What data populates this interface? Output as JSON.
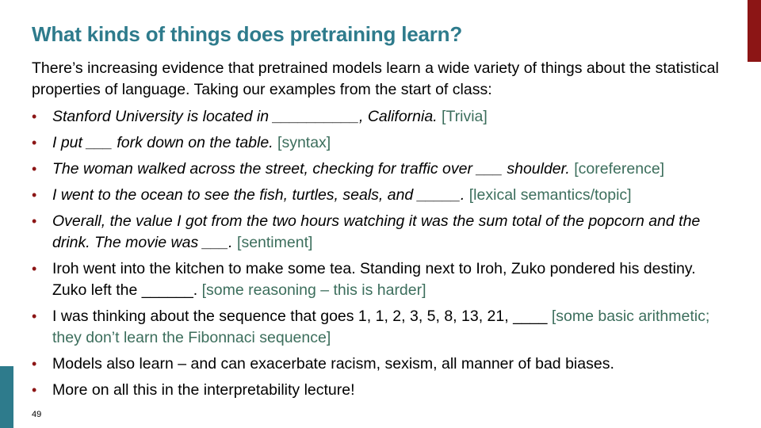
{
  "slide": {
    "title": "What kinds of things does pretraining learn?",
    "intro": "There’s increasing evidence that pretrained models learn a wide variety of things about the statistical properties of language. Taking our examples from the start of class:",
    "page_number": "49",
    "colors": {
      "title": "#2e7b8c",
      "bullet": "#8c1515",
      "tag": "#3c6e5c",
      "accent_right": "#8c1515",
      "accent_left": "#2e7b8c"
    }
  },
  "bullets": [
    {
      "text": "Stanford University is located in __________, California.",
      "tag": "[Trivia]"
    },
    {
      "text": "I put ___ fork down on the table.",
      "tag": "[syntax]"
    },
    {
      "text": "The woman walked across the street, checking for traffic over ___ shoulder.",
      "tag": "[coreference]"
    },
    {
      "text": "I went to the ocean to see the fish, turtles, seals, and _____.",
      "tag": " [lexical semantics/topic]"
    },
    {
      "text": "Overall, the value I got from the two hours watching it was the sum total of the popcorn and the drink. The movie was ___.",
      "tag": "[sentiment]"
    },
    {
      "text": "Iroh went into the kitchen to make some tea. Standing next to Iroh, Zuko pondered his destiny. Zuko left the ______.",
      "tag": "[some reasoning – this is harder]"
    },
    {
      "text": "I was thinking about the sequence that goes 1, 1, 2, 3, 5, 8, 13, 21, ____ ",
      "tag": " [some basic arithmetic; they don’t learn the Fibonnaci sequence]"
    },
    {
      "text": "Models also learn – and can exacerbate racism, sexism, all manner of bad biases.",
      "tag": ""
    },
    {
      "text": "More on all this in the interpretability lecture!",
      "tag": ""
    }
  ]
}
